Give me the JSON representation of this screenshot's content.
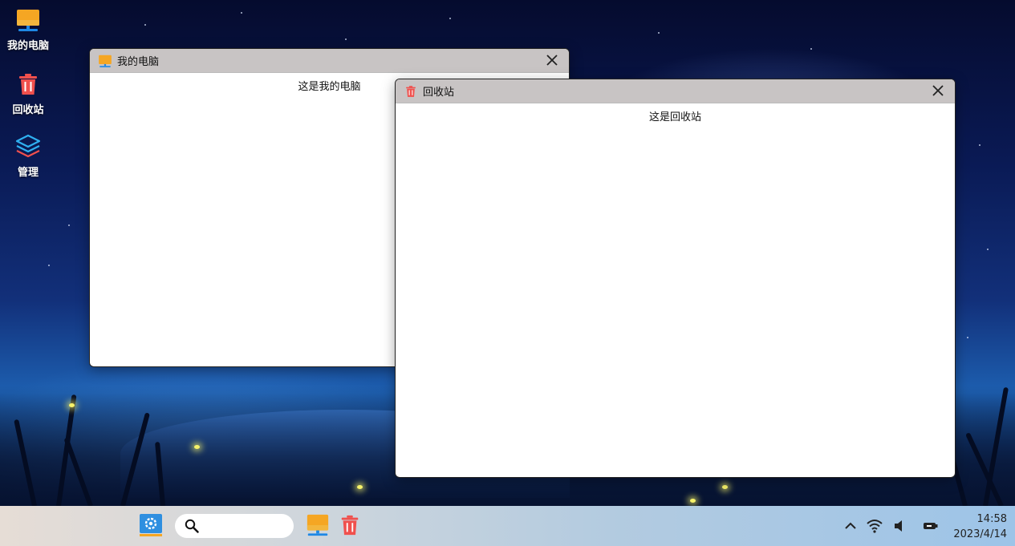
{
  "desktop": {
    "icons": [
      {
        "label": "我的电脑",
        "icon": "computer-icon"
      },
      {
        "label": "回收站",
        "icon": "trash-icon"
      },
      {
        "label": "管理",
        "icon": "layers-icon"
      }
    ]
  },
  "windows": [
    {
      "title": "我的电脑",
      "icon": "computer-icon",
      "content": "这是我的电脑"
    },
    {
      "title": "回收站",
      "icon": "trash-icon",
      "content": "这是回收站"
    }
  ],
  "taskbar": {
    "search": {
      "placeholder": "",
      "value": ""
    },
    "apps": [
      "settings-icon",
      "computer-icon",
      "trash-icon"
    ],
    "tray": [
      "chevron-up-icon",
      "wifi-icon",
      "volume-icon",
      "battery-icon"
    ],
    "time": "14:58",
    "date": "2023/4/14"
  },
  "colors": {
    "titlebar": "#c8c4c4",
    "trash_red": "#f0504d",
    "computer_orange": "#f5a623",
    "computer_blue": "#1e88e5",
    "settings_blue": "#2f8fe0"
  }
}
